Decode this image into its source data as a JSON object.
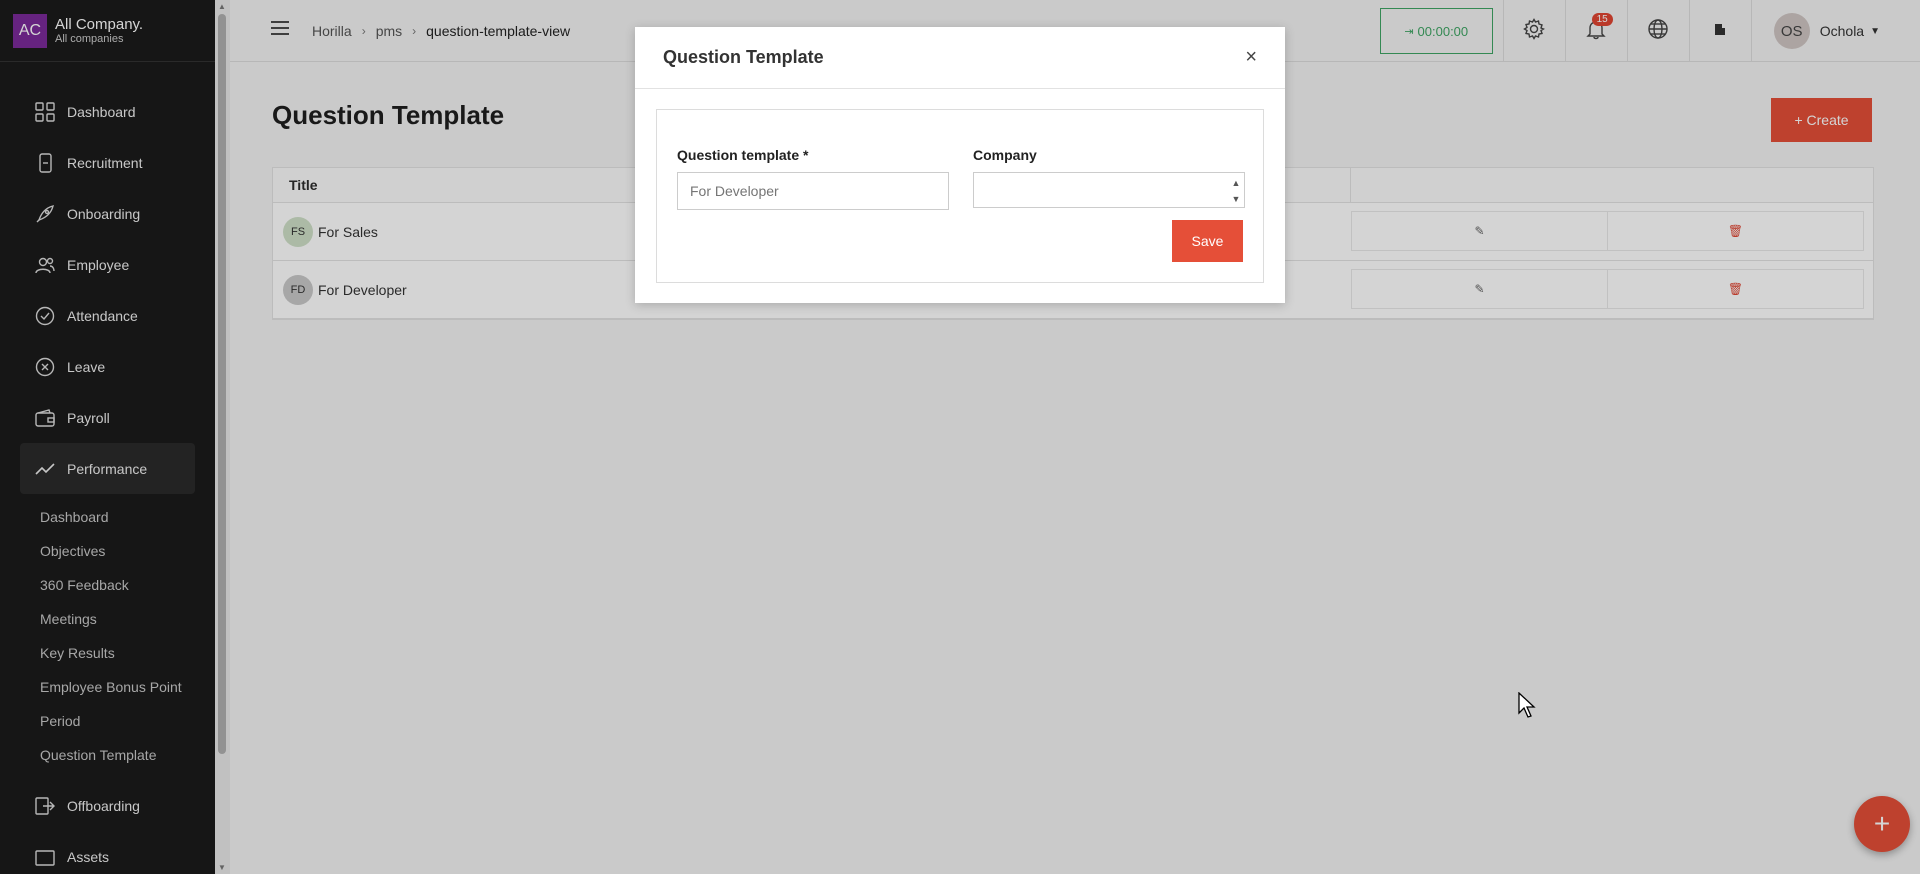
{
  "company": {
    "initials": "AC",
    "name": "All Company.",
    "sub": "All companies"
  },
  "sidebar": {
    "items": [
      {
        "label": "Dashboard",
        "icon": "grid-icon"
      },
      {
        "label": "Recruitment",
        "icon": "phone-icon"
      },
      {
        "label": "Onboarding",
        "icon": "rocket-icon"
      },
      {
        "label": "Employee",
        "icon": "users-icon"
      },
      {
        "label": "Attendance",
        "icon": "check-circle-icon"
      },
      {
        "label": "Leave",
        "icon": "x-circle-icon"
      },
      {
        "label": "Payroll",
        "icon": "wallet-icon"
      },
      {
        "label": "Performance",
        "icon": "trend-icon"
      }
    ],
    "sub_items": [
      "Dashboard",
      "Objectives",
      "360 Feedback",
      "Meetings",
      "Key Results",
      "Employee Bonus Point",
      "Period",
      "Question Template"
    ],
    "after_items": [
      {
        "label": "Offboarding",
        "icon": "exit-icon"
      },
      {
        "label": "Assets",
        "icon": "box-icon"
      }
    ]
  },
  "topbar": {
    "breadcrumb": [
      "Horilla",
      "pms",
      "question-template-view"
    ],
    "timer": "00:00:00",
    "notifications": "15",
    "user_initials": "OS",
    "user_name": "Ochola"
  },
  "page": {
    "title": "Question Template",
    "create_label": "+ Create",
    "table_header": "Title",
    "rows": [
      {
        "initials": "FS",
        "title": "For Sales",
        "avatar_color": "#cfe0c8"
      },
      {
        "initials": "FD",
        "title": "For Developer",
        "avatar_color": "#c9c9c9"
      }
    ]
  },
  "modal": {
    "title": "Question Template",
    "close": "×",
    "field1_label": "Question template *",
    "field1_placeholder": "For Developer",
    "field2_label": "Company",
    "save_label": "Save"
  },
  "colors": {
    "accent": "#e54f38",
    "sidebar": "#1b1b1b",
    "timer": "#3fa564"
  }
}
